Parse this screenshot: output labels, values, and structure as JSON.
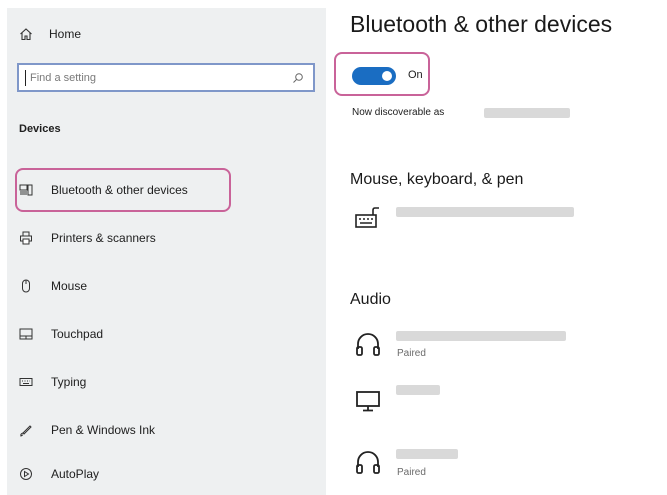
{
  "sidebar": {
    "home_label": "Home",
    "search_placeholder": "Find a setting",
    "section_title": "Devices",
    "items": [
      {
        "label": "Bluetooth & other devices",
        "icon": "bluetooth-devices-icon"
      },
      {
        "label": "Printers & scanners",
        "icon": "printer-icon"
      },
      {
        "label": "Mouse",
        "icon": "mouse-icon"
      },
      {
        "label": "Touchpad",
        "icon": "touchpad-icon"
      },
      {
        "label": "Typing",
        "icon": "keyboard-icon"
      },
      {
        "label": "Pen & Windows Ink",
        "icon": "pen-icon"
      },
      {
        "label": "AutoPlay",
        "icon": "autoplay-icon"
      }
    ]
  },
  "main": {
    "title": "Bluetooth & other devices",
    "toggle": {
      "state": "On",
      "on": true
    },
    "discoverable_label": "Now discoverable as",
    "sections": [
      {
        "title": "Mouse, keyboard, & pen"
      },
      {
        "title": "Audio"
      }
    ],
    "devices": [
      {
        "icon": "keyboard-device-icon",
        "status": ""
      },
      {
        "icon": "headphones-icon",
        "status": "Paired"
      },
      {
        "icon": "monitor-icon",
        "status": ""
      },
      {
        "icon": "headphones-icon",
        "status": "Paired"
      }
    ]
  },
  "colors": {
    "accent": "#1a6dc2",
    "highlight": "#c96399",
    "sidebar_bg": "#eef0f1"
  }
}
